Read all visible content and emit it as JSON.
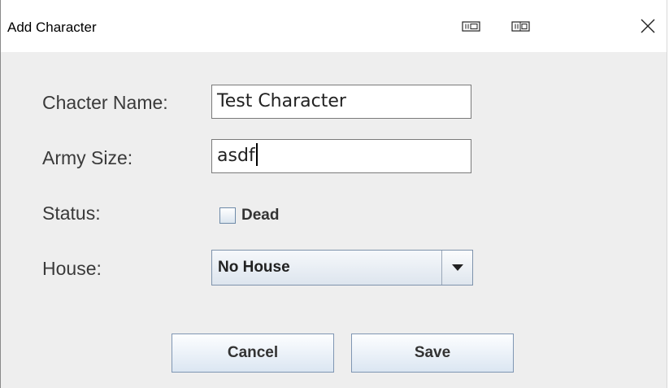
{
  "window": {
    "title": "Add Character",
    "icons": [
      "minimize-icon",
      "maximize-icon",
      "close-icon"
    ]
  },
  "form": {
    "name_label": "Chacter Name:",
    "name_value": "Test Character",
    "army_label": "Army Size:",
    "army_value": "asdf",
    "status_label": "Status:",
    "dead_label": "Dead",
    "dead_checked": false,
    "house_label": "House:",
    "house_value": "No House"
  },
  "buttons": {
    "cancel_label": "Cancel",
    "save_label": "Save"
  }
}
